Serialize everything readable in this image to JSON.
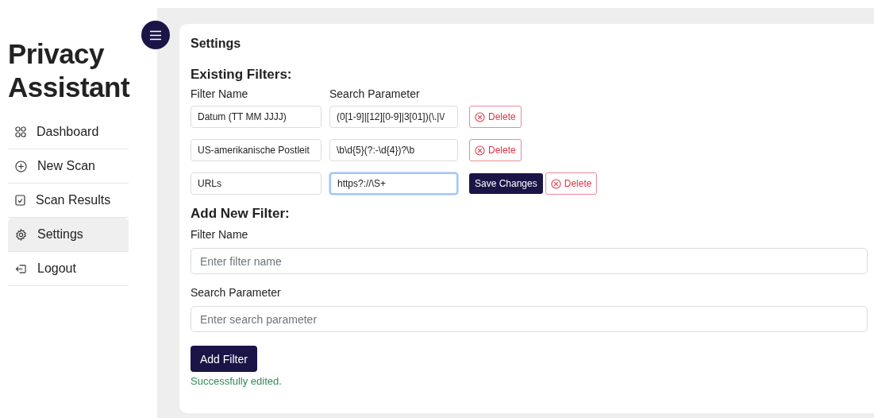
{
  "sidebar": {
    "title": "Privacy Assistant",
    "items": [
      {
        "label": "Dashboard",
        "selected": false
      },
      {
        "label": "New Scan",
        "selected": false
      },
      {
        "label": "Scan Results",
        "selected": false
      },
      {
        "label": "Settings",
        "selected": true
      },
      {
        "label": "Logout",
        "selected": false
      }
    ]
  },
  "card": {
    "title": "Settings",
    "existing_heading": "Existing Filters:",
    "columns": [
      "Filter Name",
      "Search Parameter"
    ],
    "filters": [
      {
        "name": "Datum (TT MM JJJJ)",
        "parameter": "(0[1-9]|[12][0-9]|3[01])(\\.|\\/",
        "editing": false,
        "delete": "Delete"
      },
      {
        "name": "US-amerikanische Postleit",
        "parameter": "\\b\\d{5}(?:-\\d{4})?\\b",
        "editing": false,
        "delete": "Delete"
      },
      {
        "name": "URLs",
        "parameter": "https?://\\S+",
        "editing": true,
        "save": "Save Changes",
        "delete": "Delete"
      }
    ],
    "add_heading": "Add New Filter:",
    "name_label": "Filter Name",
    "name_field": {
      "placeholder": "Enter filter name"
    },
    "param_label": "Search Parameter",
    "param_field": {
      "placeholder": "Enter search parameter"
    },
    "add_button": "Add Filter",
    "status": "Successfully edited."
  }
}
